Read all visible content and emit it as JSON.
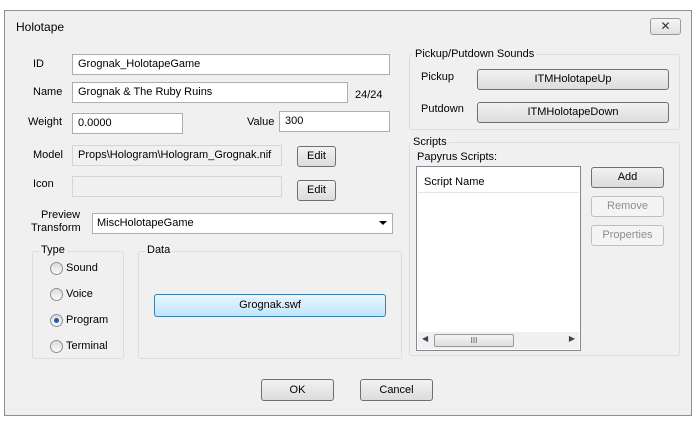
{
  "window": {
    "title": "Holotape",
    "close_glyph": "✕"
  },
  "form": {
    "id_label": "ID",
    "id_value": "Grognak_HolotapeGame",
    "name_label": "Name",
    "name_value": "Grognak & The Ruby Ruins",
    "name_count": "24/24",
    "weight_label": "Weight",
    "weight_value": "0.0000",
    "value_label": "Value",
    "value_value": "300",
    "model_label": "Model",
    "model_value": "Props\\Hologram\\Hologram_Grognak.nif",
    "model_edit": "Edit",
    "icon_label": "Icon",
    "icon_value": "",
    "icon_edit": "Edit",
    "preview_label_1": "Preview",
    "preview_label_2": "Transform",
    "preview_value": "MiscHolotapeGame"
  },
  "type_group": {
    "label": "Type",
    "options": [
      {
        "label": "Sound",
        "selected": false
      },
      {
        "label": "Voice",
        "selected": false
      },
      {
        "label": "Program",
        "selected": true
      },
      {
        "label": "Terminal",
        "selected": false
      }
    ]
  },
  "data_group": {
    "label": "Data",
    "file_button": "Grognak.swf"
  },
  "sounds": {
    "label": "Pickup/Putdown Sounds",
    "pickup_label": "Pickup",
    "pickup_value": "ITMHolotapeUp",
    "putdown_label": "Putdown",
    "putdown_value": "ITMHolotapeDown"
  },
  "scripts": {
    "label": "Scripts",
    "papyrus_label": "Papyrus Scripts:",
    "column_header": "Script Name",
    "add": "Add",
    "remove": "Remove",
    "properties": "Properties",
    "scroll_left": "◀",
    "scroll_right": "▶",
    "thumb_grip": "III"
  },
  "footer": {
    "ok": "OK",
    "cancel": "Cancel"
  }
}
